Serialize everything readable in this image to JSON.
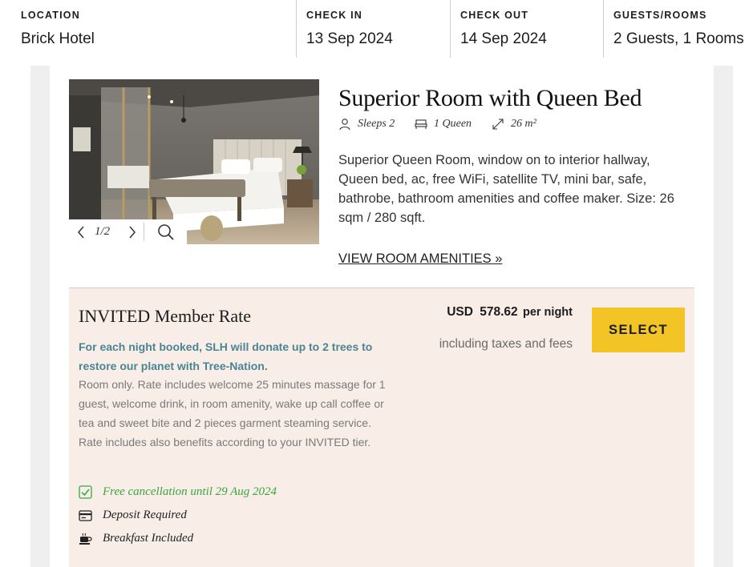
{
  "search_bar": {
    "location": {
      "label": "LOCATION",
      "value": "Brick Hotel"
    },
    "check_in": {
      "label": "CHECK IN",
      "value": "13 Sep 2024"
    },
    "check_out": {
      "label": "CHECK OUT",
      "value": "14 Sep 2024"
    },
    "guests": {
      "label": "GUESTS/ROOMS",
      "value": "2 Guests, 1 Rooms"
    }
  },
  "room": {
    "title": "Superior Room with Queen Bed",
    "features": [
      {
        "icon": "person-icon",
        "text": "Sleeps 2"
      },
      {
        "icon": "bed-icon",
        "text": "1 Queen"
      },
      {
        "icon": "expand-arrows-icon",
        "text": "26 m²"
      }
    ],
    "description": "Superior Queen Room, window on to interior hallway, Queen bed, ac, free WiFi, satellite TV, mini bar, safe, bathrobe, bathroom amenities and coffee maker. Size: 26 sqm / 280 sqft.",
    "amenities_link": "VIEW ROOM AMENITIES »",
    "gallery": {
      "counter": "1/2"
    }
  },
  "rate": {
    "title": "INVITED Member Rate",
    "promo": "For each night booked, SLH will donate up to 2 trees to restore our planet with Tree-Nation.",
    "description": "Room only. Rate includes welcome 25 minutes massage for 1 guest, welcome drink, in room amenity, wake up call coffee or tea and sweet bite and 2 pieces garment steaming service. Rate includes also benefits according to your INVITED tier.",
    "perks": [
      {
        "icon": "check-square-icon",
        "text": "Free cancellation until 29 Aug 2024"
      },
      {
        "icon": "card-icon",
        "text": "Deposit Required"
      },
      {
        "icon": "coffee-cup-icon",
        "text": "Breakfast Included"
      }
    ],
    "currency": "USD",
    "amount": "578.62",
    "per": "per night",
    "taxes": "including taxes and fees",
    "select_label": "SELECT"
  },
  "colors": {
    "accent_button": "#f2c425",
    "promo_text": "#4a8593",
    "panel_bg": "#f8ede7",
    "cancellation_green": "#3aa53f"
  }
}
